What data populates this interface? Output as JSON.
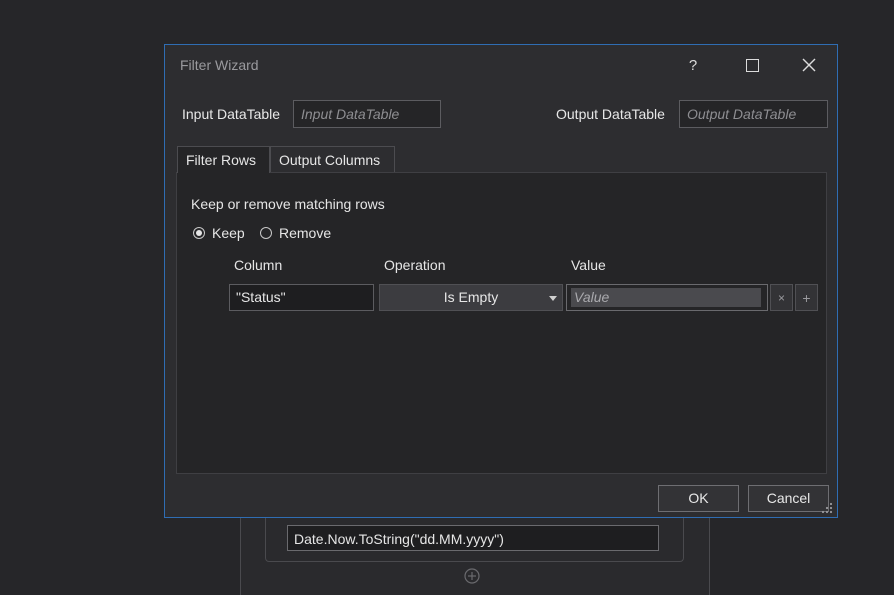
{
  "background": {
    "expression": "Date.Now.ToString(\"dd.MM.yyyy\")",
    "add_icon": "plus-circle-icon"
  },
  "dialog": {
    "title": "Filter Wizard",
    "help_label": "?",
    "close_label": "✕",
    "input_datatable": {
      "label": "Input DataTable",
      "placeholder": "Input DataTable",
      "value": ""
    },
    "output_datatable": {
      "label": "Output DataTable",
      "placeholder": "Output DataTable",
      "value": ""
    },
    "tabs": [
      {
        "label": "Filter Rows",
        "active": true
      },
      {
        "label": "Output Columns",
        "active": false
      }
    ],
    "filter_rows": {
      "caption": "Keep or remove matching rows",
      "mode_options": [
        {
          "label": "Keep",
          "selected": true
        },
        {
          "label": "Remove",
          "selected": false
        }
      ],
      "columns": [
        "Column",
        "Operation",
        "Value"
      ],
      "rows": [
        {
          "column": "\"Status\"",
          "operation": "Is Empty",
          "value_placeholder": "Value"
        }
      ],
      "remove_row_label": "×",
      "add_row_label": "+"
    },
    "ok_label": "OK",
    "cancel_label": "Cancel"
  },
  "colors": {
    "dialog_border": "#2f6db3",
    "background": "#262629",
    "dialog_bg": "#2d2d30"
  }
}
